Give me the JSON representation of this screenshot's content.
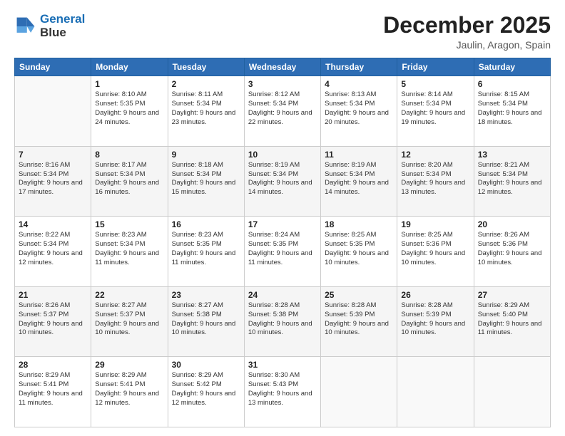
{
  "header": {
    "logo_line1": "General",
    "logo_line2": "Blue",
    "month": "December 2025",
    "location": "Jaulin, Aragon, Spain"
  },
  "weekdays": [
    "Sunday",
    "Monday",
    "Tuesday",
    "Wednesday",
    "Thursday",
    "Friday",
    "Saturday"
  ],
  "rows": [
    [
      {
        "day": "",
        "empty": true
      },
      {
        "day": "1",
        "sunrise": "8:10 AM",
        "sunset": "5:35 PM",
        "daylight": "9 hours and 24 minutes."
      },
      {
        "day": "2",
        "sunrise": "8:11 AM",
        "sunset": "5:34 PM",
        "daylight": "9 hours and 23 minutes."
      },
      {
        "day": "3",
        "sunrise": "8:12 AM",
        "sunset": "5:34 PM",
        "daylight": "9 hours and 22 minutes."
      },
      {
        "day": "4",
        "sunrise": "8:13 AM",
        "sunset": "5:34 PM",
        "daylight": "9 hours and 20 minutes."
      },
      {
        "day": "5",
        "sunrise": "8:14 AM",
        "sunset": "5:34 PM",
        "daylight": "9 hours and 19 minutes."
      },
      {
        "day": "6",
        "sunrise": "8:15 AM",
        "sunset": "5:34 PM",
        "daylight": "9 hours and 18 minutes."
      }
    ],
    [
      {
        "day": "7",
        "sunrise": "8:16 AM",
        "sunset": "5:34 PM",
        "daylight": "9 hours and 17 minutes."
      },
      {
        "day": "8",
        "sunrise": "8:17 AM",
        "sunset": "5:34 PM",
        "daylight": "9 hours and 16 minutes."
      },
      {
        "day": "9",
        "sunrise": "8:18 AM",
        "sunset": "5:34 PM",
        "daylight": "9 hours and 15 minutes."
      },
      {
        "day": "10",
        "sunrise": "8:19 AM",
        "sunset": "5:34 PM",
        "daylight": "9 hours and 14 minutes."
      },
      {
        "day": "11",
        "sunrise": "8:19 AM",
        "sunset": "5:34 PM",
        "daylight": "9 hours and 14 minutes."
      },
      {
        "day": "12",
        "sunrise": "8:20 AM",
        "sunset": "5:34 PM",
        "daylight": "9 hours and 13 minutes."
      },
      {
        "day": "13",
        "sunrise": "8:21 AM",
        "sunset": "5:34 PM",
        "daylight": "9 hours and 12 minutes."
      }
    ],
    [
      {
        "day": "14",
        "sunrise": "8:22 AM",
        "sunset": "5:34 PM",
        "daylight": "9 hours and 12 minutes."
      },
      {
        "day": "15",
        "sunrise": "8:23 AM",
        "sunset": "5:34 PM",
        "daylight": "9 hours and 11 minutes."
      },
      {
        "day": "16",
        "sunrise": "8:23 AM",
        "sunset": "5:35 PM",
        "daylight": "9 hours and 11 minutes."
      },
      {
        "day": "17",
        "sunrise": "8:24 AM",
        "sunset": "5:35 PM",
        "daylight": "9 hours and 11 minutes."
      },
      {
        "day": "18",
        "sunrise": "8:25 AM",
        "sunset": "5:35 PM",
        "daylight": "9 hours and 10 minutes."
      },
      {
        "day": "19",
        "sunrise": "8:25 AM",
        "sunset": "5:36 PM",
        "daylight": "9 hours and 10 minutes."
      },
      {
        "day": "20",
        "sunrise": "8:26 AM",
        "sunset": "5:36 PM",
        "daylight": "9 hours and 10 minutes."
      }
    ],
    [
      {
        "day": "21",
        "sunrise": "8:26 AM",
        "sunset": "5:37 PM",
        "daylight": "9 hours and 10 minutes."
      },
      {
        "day": "22",
        "sunrise": "8:27 AM",
        "sunset": "5:37 PM",
        "daylight": "9 hours and 10 minutes."
      },
      {
        "day": "23",
        "sunrise": "8:27 AM",
        "sunset": "5:38 PM",
        "daylight": "9 hours and 10 minutes."
      },
      {
        "day": "24",
        "sunrise": "8:28 AM",
        "sunset": "5:38 PM",
        "daylight": "9 hours and 10 minutes."
      },
      {
        "day": "25",
        "sunrise": "8:28 AM",
        "sunset": "5:39 PM",
        "daylight": "9 hours and 10 minutes."
      },
      {
        "day": "26",
        "sunrise": "8:28 AM",
        "sunset": "5:39 PM",
        "daylight": "9 hours and 10 minutes."
      },
      {
        "day": "27",
        "sunrise": "8:29 AM",
        "sunset": "5:40 PM",
        "daylight": "9 hours and 11 minutes."
      }
    ],
    [
      {
        "day": "28",
        "sunrise": "8:29 AM",
        "sunset": "5:41 PM",
        "daylight": "9 hours and 11 minutes."
      },
      {
        "day": "29",
        "sunrise": "8:29 AM",
        "sunset": "5:41 PM",
        "daylight": "9 hours and 12 minutes."
      },
      {
        "day": "30",
        "sunrise": "8:29 AM",
        "sunset": "5:42 PM",
        "daylight": "9 hours and 12 minutes."
      },
      {
        "day": "31",
        "sunrise": "8:30 AM",
        "sunset": "5:43 PM",
        "daylight": "9 hours and 13 minutes."
      },
      {
        "day": "",
        "empty": true
      },
      {
        "day": "",
        "empty": true
      },
      {
        "day": "",
        "empty": true
      }
    ]
  ]
}
